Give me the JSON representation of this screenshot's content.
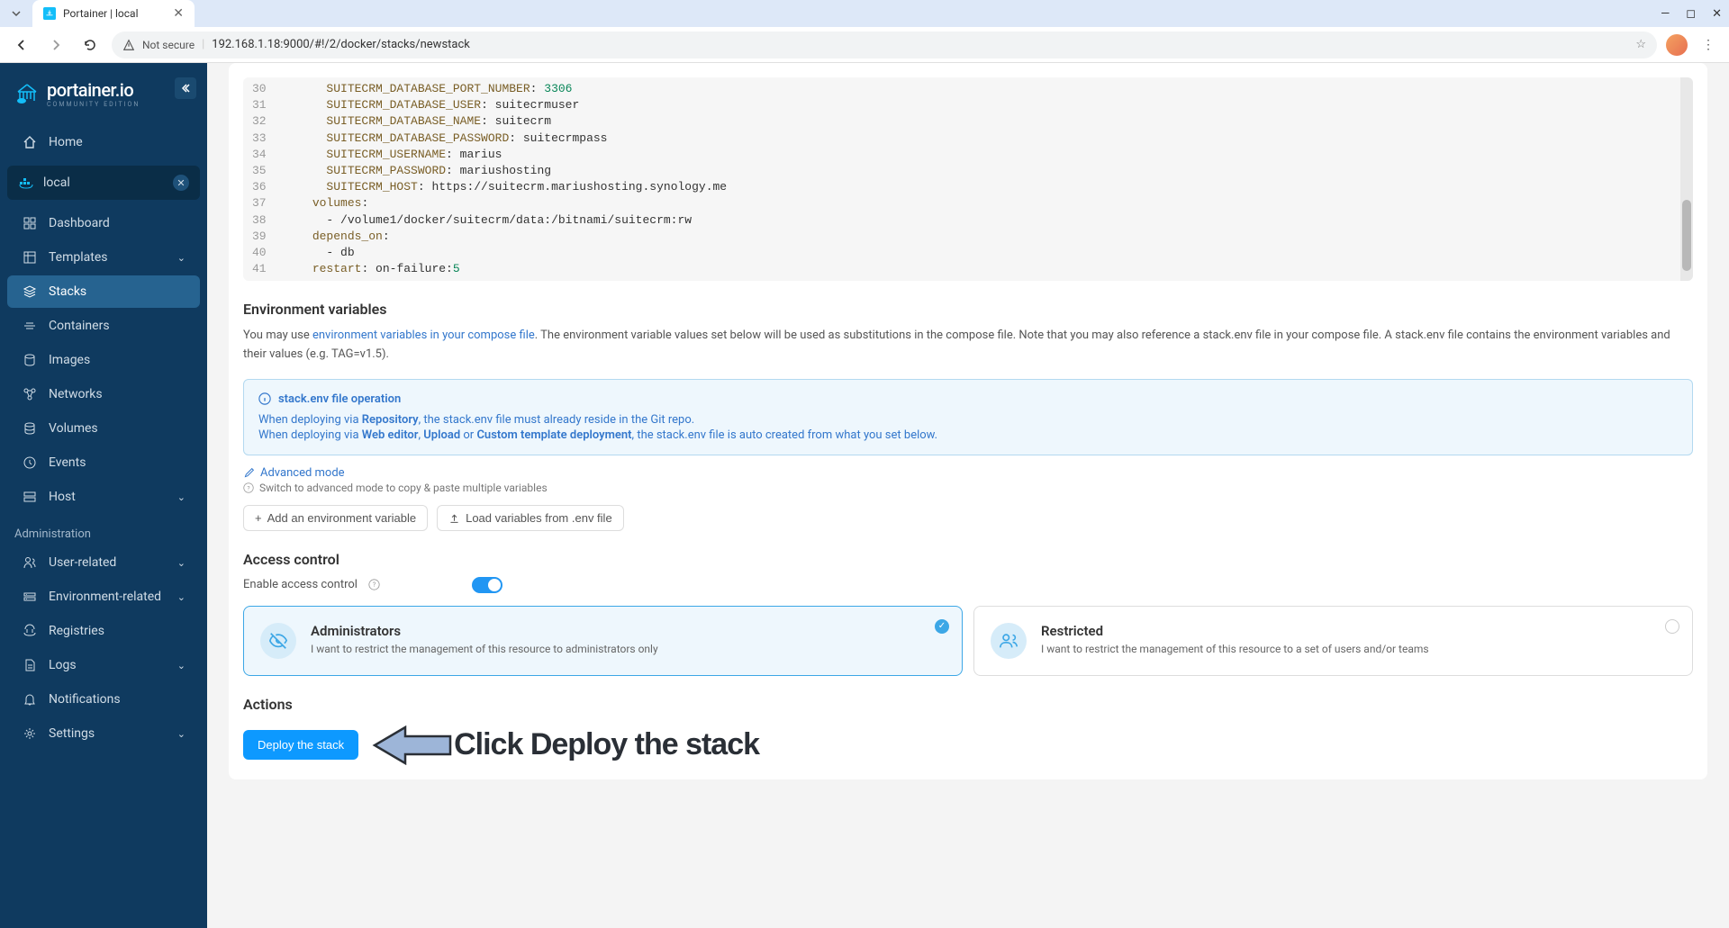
{
  "browser": {
    "tab_title": "Portainer | local",
    "url": "192.168.1.18:9000/#!/2/docker/stacks/newstack",
    "security_label": "Not secure"
  },
  "sidebar": {
    "brand": "portainer.io",
    "edition": "COMMUNITY EDITION",
    "home": "Home",
    "env_name": "local",
    "items": [
      {
        "label": "Dashboard"
      },
      {
        "label": "Templates",
        "expandable": true
      },
      {
        "label": "Stacks",
        "active": true
      },
      {
        "label": "Containers"
      },
      {
        "label": "Images"
      },
      {
        "label": "Networks"
      },
      {
        "label": "Volumes"
      },
      {
        "label": "Events"
      },
      {
        "label": "Host",
        "expandable": true
      }
    ],
    "admin_section": "Administration",
    "admin_items": [
      {
        "label": "User-related",
        "expandable": true
      },
      {
        "label": "Environment-related",
        "expandable": true
      },
      {
        "label": "Registries"
      },
      {
        "label": "Logs",
        "expandable": true
      },
      {
        "label": "Notifications"
      },
      {
        "label": "Settings",
        "expandable": true
      }
    ]
  },
  "code": {
    "lines": [
      {
        "n": 30,
        "indent": 6,
        "key": "SUITECRM_DATABASE_PORT_NUMBER",
        "val": "3306",
        "isnum": true
      },
      {
        "n": 31,
        "indent": 6,
        "key": "SUITECRM_DATABASE_USER",
        "val": "suitecrmuser"
      },
      {
        "n": 32,
        "indent": 6,
        "key": "SUITECRM_DATABASE_NAME",
        "val": "suitecrm"
      },
      {
        "n": 33,
        "indent": 6,
        "key": "SUITECRM_DATABASE_PASSWORD",
        "val": "suitecrmpass"
      },
      {
        "n": 34,
        "indent": 6,
        "key": "SUITECRM_USERNAME",
        "val": "marius"
      },
      {
        "n": 35,
        "indent": 6,
        "key": "SUITECRM_PASSWORD",
        "val": "mariushosting"
      },
      {
        "n": 36,
        "indent": 6,
        "key": "SUITECRM_HOST",
        "val": "https://suitecrm.mariushosting.synology.me"
      },
      {
        "n": 37,
        "indent": 4,
        "key": "volumes",
        "val": ""
      },
      {
        "n": 38,
        "indent": 6,
        "plain": "- /volume1/docker/suitecrm/data:/bitnami/suitecrm:rw"
      },
      {
        "n": 39,
        "indent": 4,
        "key": "depends_on",
        "val": ""
      },
      {
        "n": 40,
        "indent": 6,
        "plain": "- db"
      },
      {
        "n": 41,
        "indent": 4,
        "key": "restart",
        "val": "on-failure:",
        "numsuffix": "5"
      }
    ]
  },
  "env": {
    "title": "Environment variables",
    "desc_pre": "You may use ",
    "desc_link": "environment variables in your compose file",
    "desc_post": ". The environment variable values set below will be used as substitutions in the compose file. Note that you may also reference a stack.env file in your compose file. A stack.env file contains the environment variables and their values (e.g. TAG=v1.5).",
    "info_title": "stack.env file operation",
    "info_line1_pre": "When deploying via ",
    "info_line1_b": "Repository",
    "info_line1_post": ", the stack.env file must already reside in the Git repo.",
    "info_line2_pre": "When deploying via ",
    "info_line2_b1": "Web editor",
    "info_line2_sep1": ", ",
    "info_line2_b2": "Upload",
    "info_line2_sep2": " or ",
    "info_line2_b3": "Custom template deployment",
    "info_line2_post": ", the stack.env file is auto created from what you set below.",
    "adv_link": "Advanced mode",
    "adv_hint": "Switch to advanced mode to copy & paste multiple variables",
    "btn_add": "Add an environment variable",
    "btn_load": "Load variables from .env file"
  },
  "access": {
    "title": "Access control",
    "toggle_label": "Enable access control",
    "admin_title": "Administrators",
    "admin_desc": "I want to restrict the management of this resource to administrators only",
    "restricted_title": "Restricted",
    "restricted_desc": "I want to restrict the management of this resource to a set of users and/or teams"
  },
  "actions": {
    "title": "Actions",
    "deploy_btn": "Deploy the stack",
    "annotation": "Click Deploy the stack"
  }
}
